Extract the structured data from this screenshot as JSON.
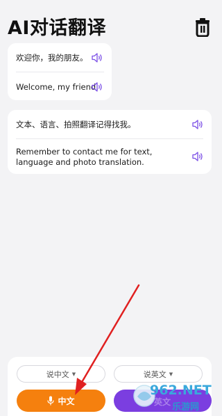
{
  "header": {
    "title": "AI对话翻译",
    "trash_icon": "trash-icon"
  },
  "conversations": [
    {
      "source_text": "欢迎你，我的朋友。",
      "translated_text": "Welcome, my friend."
    },
    {
      "source_text": "文本、语言、拍照翻译记得找我。",
      "translated_text": "Remember to contact me for text, language and photo translation."
    }
  ],
  "bottom": {
    "left_lang_label": "说中文",
    "right_lang_label": "说英文",
    "left_button_label": "中文",
    "right_button_label": "英文"
  },
  "watermark": {
    "brand": "962.NET",
    "sub": "乐游网"
  },
  "colors": {
    "accent_orange": "#f5800e",
    "accent_purple": "#7b3ee0",
    "speaker_purple": "#7b4fe6",
    "annotation_arrow": "#e02020"
  }
}
